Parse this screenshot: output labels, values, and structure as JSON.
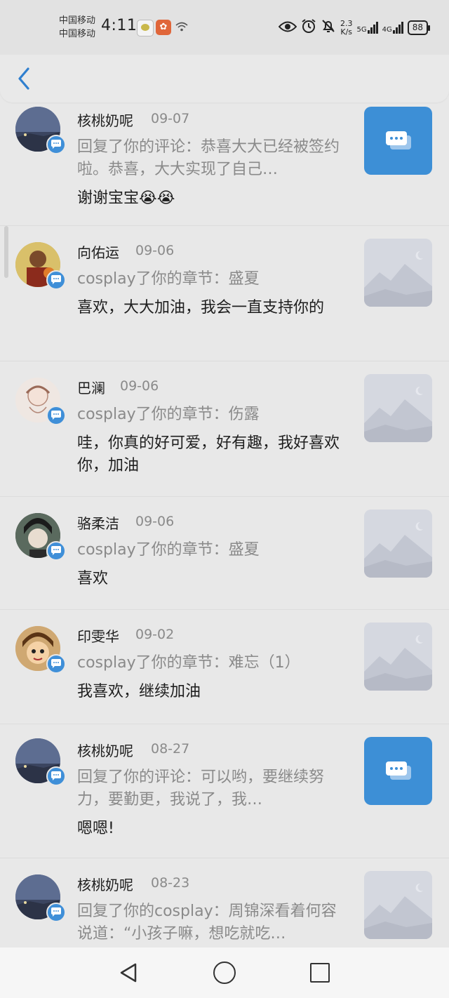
{
  "status": {
    "carrier1": "中国移动",
    "carrier2": "中国移动",
    "time": "4:11",
    "speed_value": "2.3",
    "speed_unit": "K/s",
    "net1": "5G",
    "net2": "4G",
    "battery": "88"
  },
  "items": [
    {
      "name": "核桃奶呢",
      "date": "09-07",
      "sub": "回复了你的评论：恭喜大大已经被签约啦。恭喜，大大实现了自己…",
      "msg": "谢谢宝宝😭😭",
      "thumb": "comment"
    },
    {
      "name": "向佑运",
      "date": "09-06",
      "sub": "cosplay了你的章节：盛夏",
      "msg": "喜欢，大大加油，我会一直支持你的",
      "thumb": "image"
    },
    {
      "name": "巴澜",
      "date": "09-06",
      "sub": "cosplay了你的章节：伤露",
      "msg": "哇，你真的好可爱，好有趣，我好喜欢你，加油",
      "thumb": "image"
    },
    {
      "name": "骆柔洁",
      "date": "09-06",
      "sub": "cosplay了你的章节：盛夏",
      "msg": "喜欢",
      "thumb": "image"
    },
    {
      "name": "印雯华",
      "date": "09-02",
      "sub": "cosplay了你的章节：难忘（1）",
      "msg": "我喜欢，继续加油",
      "thumb": "image"
    },
    {
      "name": "核桃奶呢",
      "date": "08-27",
      "sub": "回复了你的评论：可以哟，要继续努力，要勤更，我说了，我…",
      "msg": "嗯嗯!",
      "thumb": "comment"
    },
    {
      "name": "核桃奶呢",
      "date": "08-23",
      "sub": "回复了你的cosplay：周锦深看着何容说道：“小孩子嘛，想吃就吃…",
      "msg": "",
      "thumb": "image"
    }
  ]
}
